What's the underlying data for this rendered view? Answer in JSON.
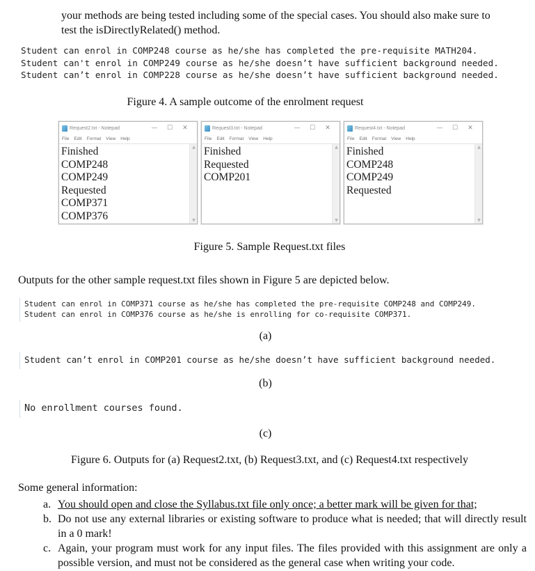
{
  "intro": {
    "lines": [
      "your methods are being tested including some of the special cases. You should also make sure to",
      "test the isDirectlyRelated() method."
    ]
  },
  "figure4": {
    "output_lines": [
      "Student can enrol in COMP248 course as he/she has completed the pre-requisite MATH204.",
      "Student can't enrol in COMP249 course as he/she doesn’t have sufficient background needed.",
      "Student can’t enrol in COMP228 course as he/she doesn’t have sufficient background needed."
    ],
    "caption": "Figure 4. A sample outcome of the enrolment request"
  },
  "figure5": {
    "notepads": [
      {
        "title": "Request2.txt - Notepad",
        "menu": [
          "File",
          "Edit",
          "Format",
          "View",
          "Help"
        ],
        "lines": [
          "Finished",
          "COMP248",
          "COMP249",
          "Requested",
          "COMP371",
          "COMP376"
        ]
      },
      {
        "title": "Request3.txt - Notepad",
        "menu": [
          "File",
          "Edit",
          "Format",
          "View",
          "Help"
        ],
        "lines": [
          "Finished",
          "Requested",
          "COMP201"
        ]
      },
      {
        "title": "Request4.txt - Notepad",
        "menu": [
          "File",
          "Edit",
          "Format",
          "View",
          "Help"
        ],
        "lines": [
          "Finished",
          "COMP248",
          "COMP249",
          "Requested"
        ]
      }
    ],
    "window_controls": {
      "minimize": "—",
      "maximize": "☐",
      "close": "✕"
    },
    "scroll_arrows": {
      "up": "▲",
      "down": "▼"
    },
    "caption": "Figure 5. Sample Request.txt files"
  },
  "outputs_intro": "Outputs for the other sample request.txt files shown in Figure 5 are depicted below.",
  "figure6": {
    "a": {
      "lines": [
        "Student can enrol in COMP371 course as he/she has completed the pre-requisite COMP248 and COMP249.",
        "Student can enrol in COMP376 course as he/she is enrolling for co-requisite COMP371."
      ],
      "label": "(a)"
    },
    "b": {
      "lines": [
        "Student can’t enrol in COMP201 course as he/she doesn’t have sufficient background needed."
      ],
      "label": "(b)"
    },
    "c": {
      "lines": [
        "No enrollment courses found."
      ],
      "label": "(c)"
    },
    "caption": "Figure 6. Outputs for (a) Request2.txt, (b) Request3.txt, and (c) Request4.txt respectively"
  },
  "general": {
    "heading": "Some general information:",
    "items": [
      {
        "marker": "a.",
        "text": "You should open and close the Syllabus.txt file only once; a better mark will be given for that;"
      },
      {
        "marker": "b.",
        "text": "Do not use any external libraries or existing software to produce what is needed; that will directly result in a 0 mark!"
      },
      {
        "marker": "c.",
        "text": "Again, your program must work for any input files. The files provided with this assignment are only a possible version, and must not be considered as the general case when writing your code."
      }
    ]
  }
}
